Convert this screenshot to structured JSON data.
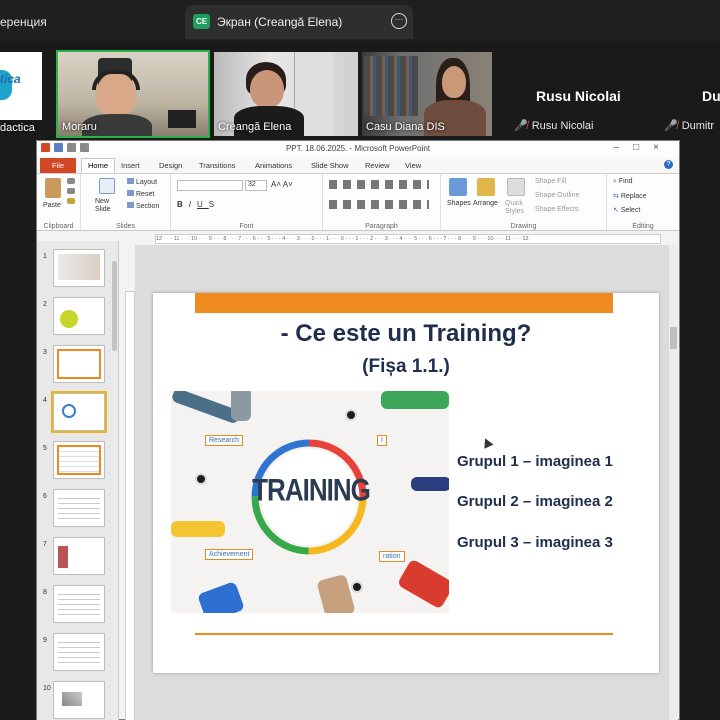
{
  "zoom": {
    "tab1_title": "еренция",
    "tab2_badge": "CE",
    "tab2_title": "Экран (Creangă Elena)",
    "more_icon": "more-options-icon"
  },
  "participants": {
    "tile0_name": "dactica",
    "tile0_logo": "tica",
    "tile1_name": "Moraru",
    "tile2_name": "Creangă Elena",
    "tile3_name": "Casu Diana DIS",
    "tile4_big": "Rusu Nicolai",
    "tile4_name": "Rusu Nicolai",
    "tile5_big": "Du",
    "tile5_name": "Dumitr",
    "active_color": "#28b34a"
  },
  "ppt": {
    "window_title": "PPT. 18.06.2025. - Microsoft PowerPoint",
    "tabs": [
      "File",
      "Home",
      "Insert",
      "Design",
      "Transitions",
      "Animations",
      "Slide Show",
      "Review",
      "View"
    ],
    "ribbon": {
      "paste": "Paste",
      "new_slide": "New Slide",
      "layout": "Layout",
      "reset": "Reset",
      "section": "Section",
      "font_size": "32",
      "shapes": "Shapes",
      "arrange": "Arrange",
      "quick_styles": "Quick Styles",
      "shape_fill": "Shape Fill",
      "shape_outline": "Shape Outline",
      "shape_effects": "Shape Effects",
      "find": "Find",
      "replace": "Replace",
      "select": "Select",
      "groups": [
        "Clipboard",
        "Slides",
        "Font",
        "Paragraph",
        "Drawing",
        "Editing"
      ]
    },
    "ruler_text": "12 · · · 11 · · · 10 · · · 9 · · · 8 · · · 7 · · · 6 · · · 5 · · · 4 · · · 3 · · · 2 · · · 1 · · · 0 · · · 1 · · · 2 · · · 3 · · · 4 · · · 5 · · · 6 · · · 7 · · · 8 · · · 9 · · · 10 · · · 11 · · · 12",
    "thumb_numbers": [
      "1",
      "2",
      "3",
      "4",
      "5",
      "6",
      "7",
      "8",
      "9",
      "10"
    ],
    "selected_slide": "4",
    "slide": {
      "title": "- Ce este un Training?",
      "subtitle": "(Fișa 1.1.)",
      "image_word": "TRAINING",
      "tag_research": "Research",
      "tag_achievement": "Achievement",
      "tag_i": "I",
      "tag_ration": "ration",
      "groups": [
        "Grupul 1 – imaginea 1",
        "Grupul 2 – imaginea 2",
        "Grupul 3 – imaginea 3"
      ],
      "accent": "#ee8a1f",
      "text_color": "#1f2d4e"
    }
  }
}
